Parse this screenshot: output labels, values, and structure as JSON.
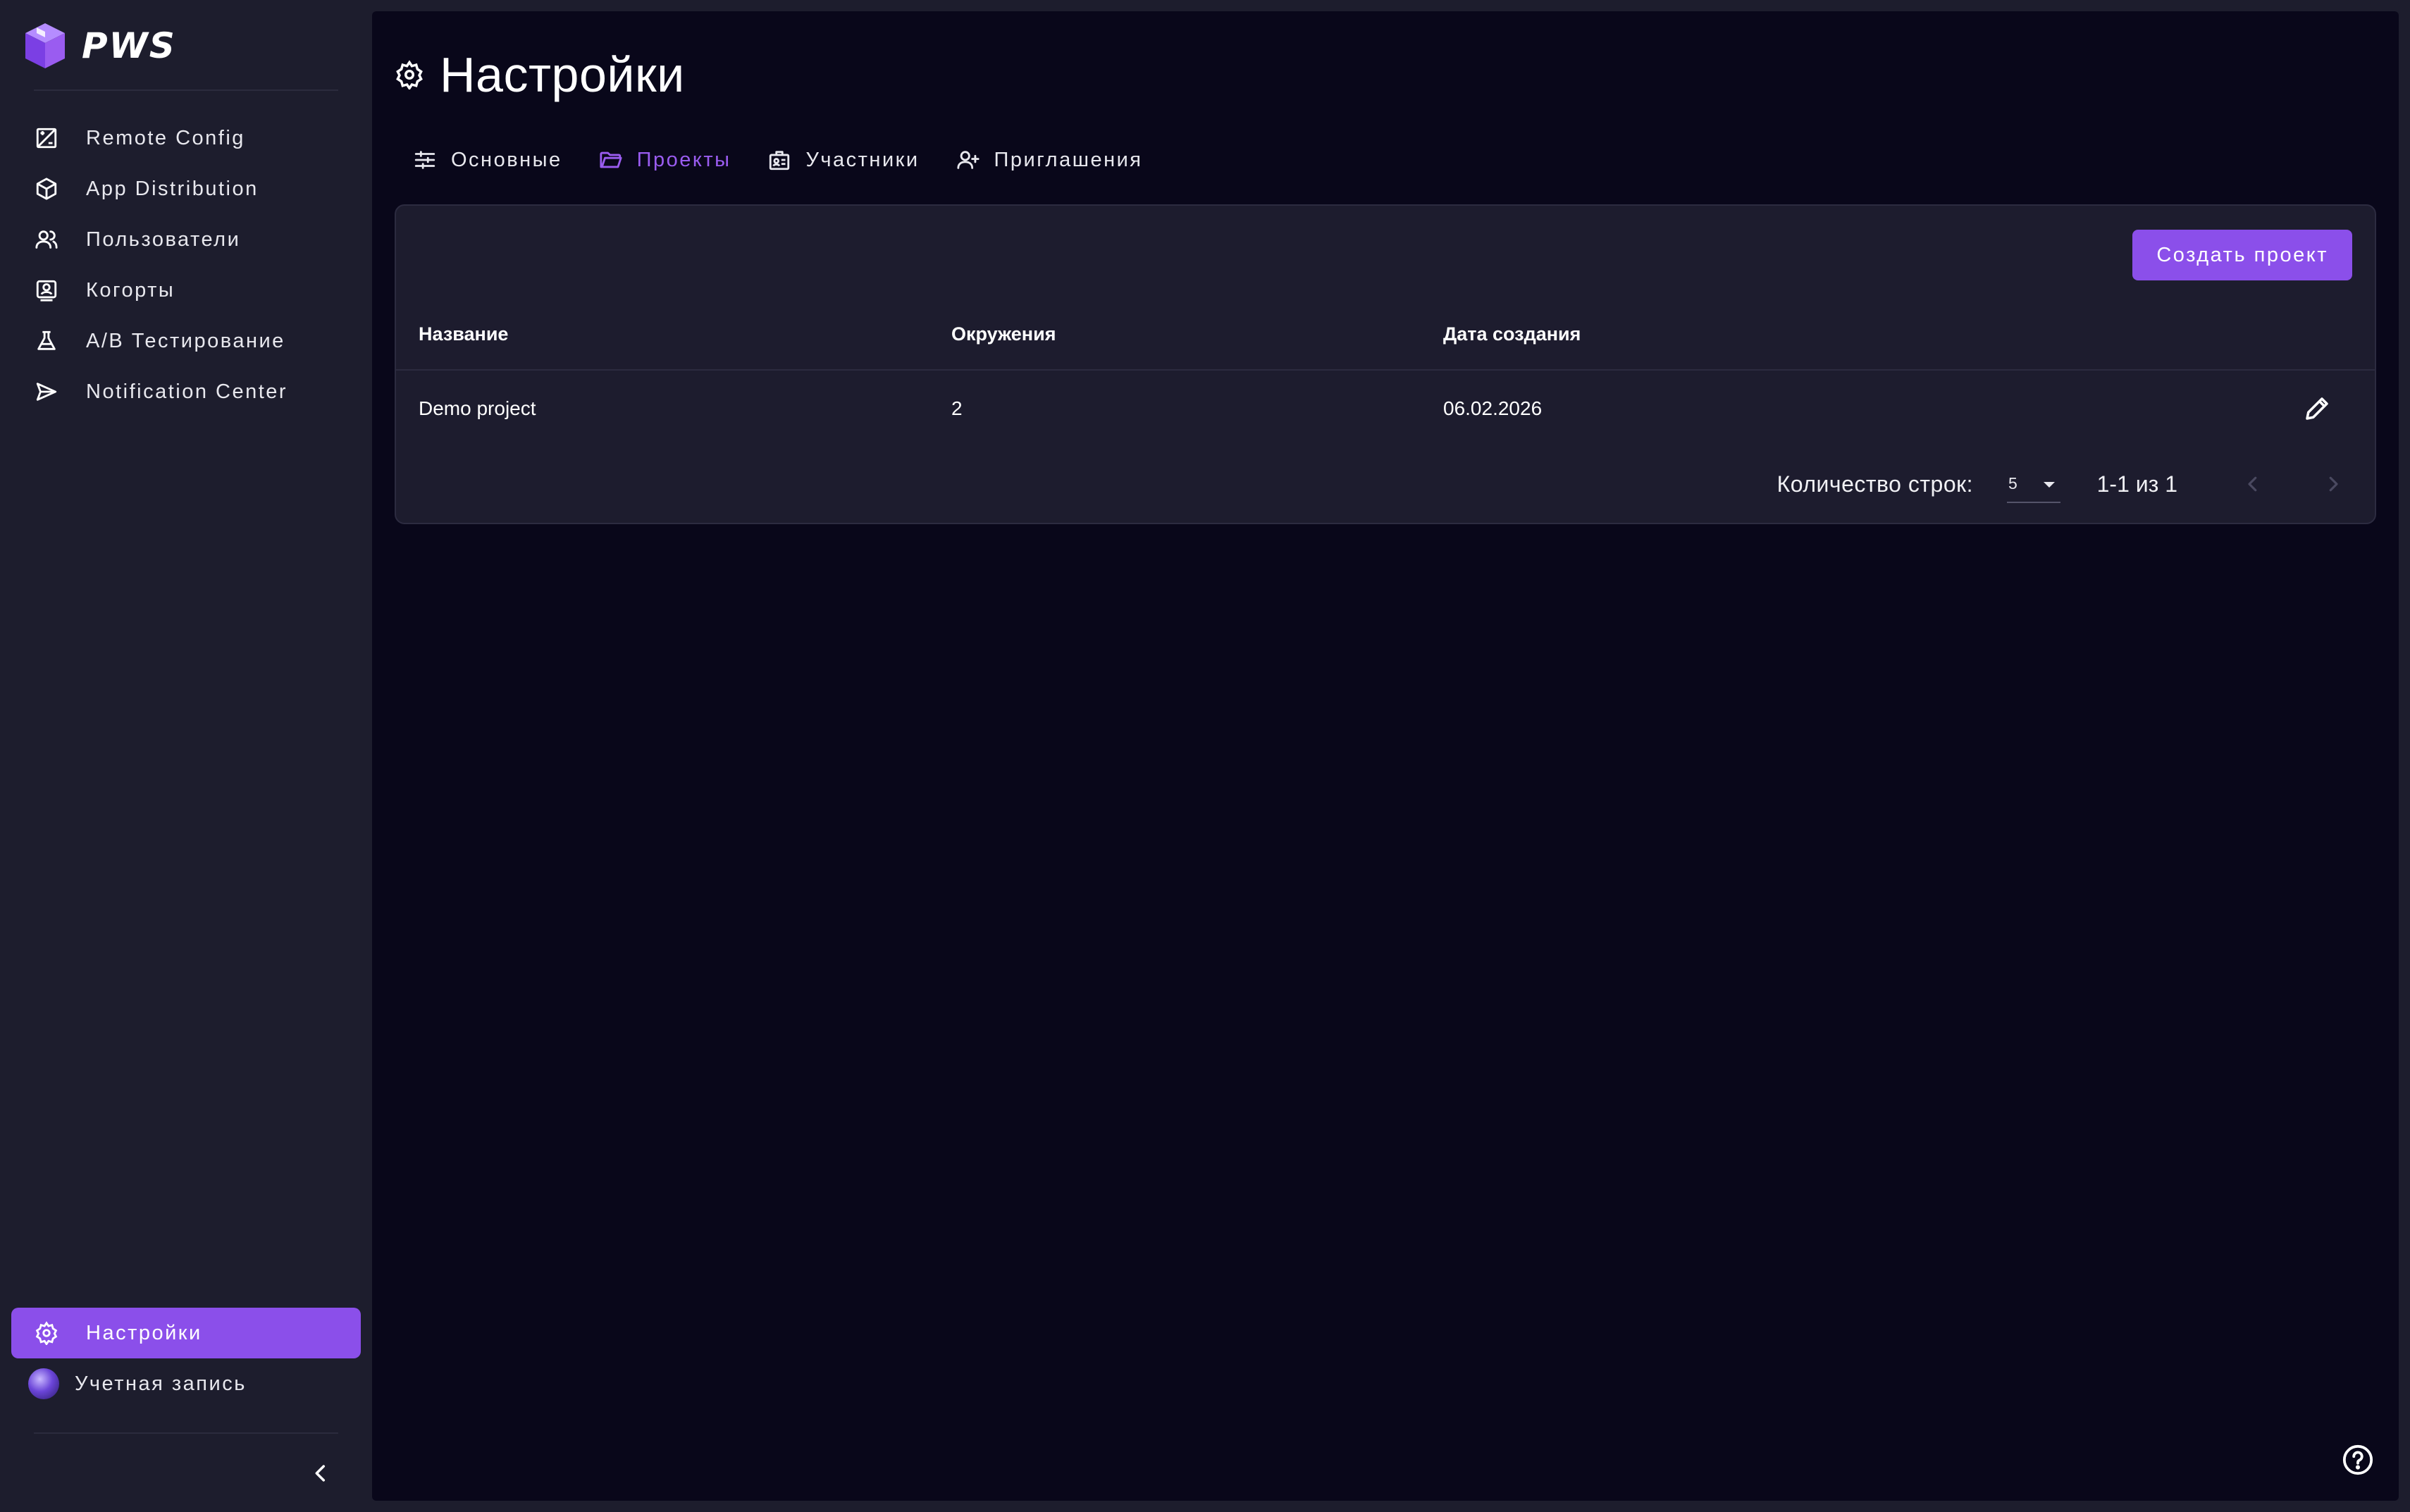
{
  "brand": {
    "name": "PWS"
  },
  "sidebar": {
    "items": [
      {
        "label": "Remote Config",
        "icon": "remote-config-icon"
      },
      {
        "label": "App Distribution",
        "icon": "cube-icon"
      },
      {
        "label": "Пользователи",
        "icon": "users-icon"
      },
      {
        "label": "Когорты",
        "icon": "cohort-icon"
      },
      {
        "label": "A/B Тестирование",
        "icon": "flask-icon"
      },
      {
        "label": "Notification Center",
        "icon": "send-icon"
      }
    ],
    "settings_label": "Настройки",
    "account_label": "Учетная запись"
  },
  "page": {
    "title": "Настройки",
    "tabs": [
      {
        "label": "Основные",
        "icon": "sliders-icon"
      },
      {
        "label": "Проекты",
        "icon": "folder-icon",
        "active": true
      },
      {
        "label": "Участники",
        "icon": "id-badge-icon"
      },
      {
        "label": "Приглашения",
        "icon": "user-plus-icon"
      }
    ]
  },
  "projects": {
    "create_label": "Создать проект",
    "columns": [
      "Название",
      "Окружения",
      "Дата создания"
    ],
    "rows": [
      {
        "name": "Demo project",
        "environments": "2",
        "created": "06.02.2026"
      }
    ],
    "pagination": {
      "rows_label": "Количество строк:",
      "rows_per_page": "5",
      "range": "1-1 из 1"
    }
  },
  "colors": {
    "accent": "#8b4fea",
    "sidebar_bg": "#1d1d2d",
    "main_bg": "#09071a",
    "card_bg": "#1d1c2e"
  }
}
